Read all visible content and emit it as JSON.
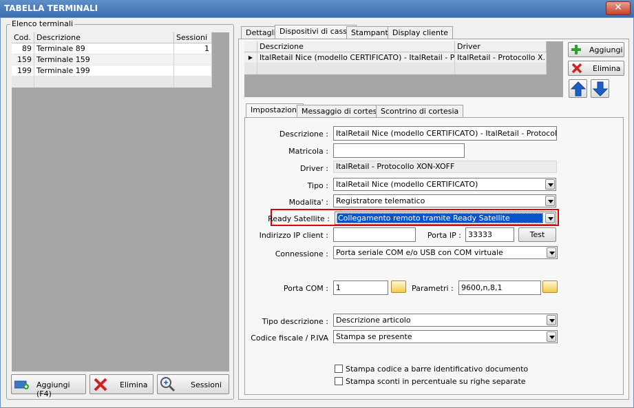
{
  "window": {
    "title": "TABELLA TERMINALI",
    "close_glyph": "✕"
  },
  "terminals": {
    "group_label": "Elenco terminali",
    "columns": [
      "Cod.",
      "Descrizione",
      "Sessioni"
    ],
    "rows": [
      {
        "cod": "89",
        "descrizione": "Terminale 89",
        "sessioni": "1"
      },
      {
        "cod": "159",
        "descrizione": "Terminale 159",
        "sessioni": ""
      },
      {
        "cod": "199",
        "descrizione": "Terminale 199",
        "sessioni": ""
      }
    ],
    "buttons": {
      "add": "Aggiungi (F4)",
      "delete": "Elimina",
      "sessions": "Sessioni"
    }
  },
  "main_tabs": [
    "Dettagli",
    "Dispositivi di cassa",
    "Stampanti",
    "Display cliente"
  ],
  "devices": {
    "columns": [
      "Descrizione",
      "Driver"
    ],
    "rows": [
      {
        "descrizione": "ItalRetail Nice (modello CERTIFICATO) - ItalRetail - Prot...",
        "driver": "ItalRetail - Protocollo X..."
      }
    ],
    "buttons": {
      "add": "Aggiungi",
      "delete": "Elimina"
    },
    "row_marker": "▶"
  },
  "sub_tabs": [
    "Impostazioni",
    "Messaggio di cortesia",
    "Scontrino di cortesia"
  ],
  "form": {
    "descrizione_label": "Descrizione :",
    "descrizione_value": "ItalRetail Nice (modello CERTIFICATO) - ItalRetail - Protocollo XON",
    "matricola_label": "Matricola :",
    "matricola_value": "",
    "driver_label": "Driver :",
    "driver_value": "ItalRetail - Protocollo XON-XOFF",
    "tipo_label": "Tipo :",
    "tipo_value": "ItalRetail Nice (modello CERTIFICATO)",
    "modalita_label": "Modalita' :",
    "modalita_value": "Registratore telematico",
    "ready_label": "Ready Satellite :",
    "ready_value": "Collegamento remoto tramite Ready Satellite",
    "ip_client_label": "Indirizzo IP client :",
    "ip_client_value": "",
    "porta_ip_label": "Porta IP :",
    "porta_ip_value": "33333",
    "test_label": "Test",
    "connessione_label": "Connessione :",
    "connessione_value": "Porta seriale COM e/o USB con COM virtuale",
    "porta_com_label": "Porta COM :",
    "porta_com_value": "1",
    "parametri_label": "Parametri :",
    "parametri_value": "9600,n,8,1",
    "tipo_desc_label": "Tipo descrizione :",
    "tipo_desc_value": "Descrizione articolo",
    "cf_label": "Codice fiscale / P.IVA",
    "cf_value": "Stampa se presente",
    "chk1_label": "Stampa codice a barre identificativo documento",
    "chk2_label": "Stampa sconti in percentuale su righe separate"
  },
  "colors": {
    "titlebar": "#3b6cae",
    "highlight_border": "#e00000",
    "selection": "#0a54c8",
    "add_green": "#2fa12f",
    "delete_red": "#d02020",
    "arrow_blue": "#1d5fc4"
  }
}
